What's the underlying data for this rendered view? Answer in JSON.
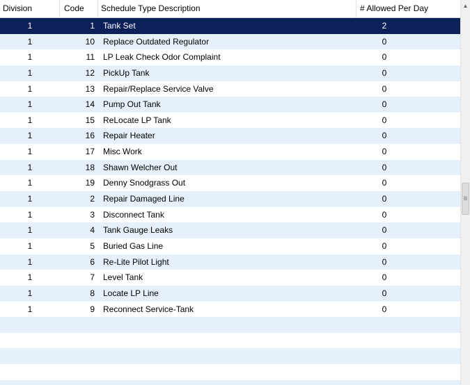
{
  "headers": {
    "division": "Division",
    "code": "Code",
    "description": "Schedule Type Description",
    "allowed": "# Allowed Per Day"
  },
  "rows": [
    {
      "division": "1",
      "code": "1",
      "description": "Tank Set",
      "allowed": "2"
    },
    {
      "division": "1",
      "code": "10",
      "description": "Replace Outdated Regulator",
      "allowed": "0"
    },
    {
      "division": "1",
      "code": "11",
      "description": "LP Leak Check Odor Complaint",
      "allowed": "0"
    },
    {
      "division": "1",
      "code": "12",
      "description": "PickUp Tank",
      "allowed": "0"
    },
    {
      "division": "1",
      "code": "13",
      "description": "Repair/Replace Service Valve",
      "allowed": "0"
    },
    {
      "division": "1",
      "code": "14",
      "description": "Pump Out Tank",
      "allowed": "0"
    },
    {
      "division": "1",
      "code": "15",
      "description": "ReLocate LP Tank",
      "allowed": "0"
    },
    {
      "division": "1",
      "code": "16",
      "description": "Repair Heater",
      "allowed": "0"
    },
    {
      "division": "1",
      "code": "17",
      "description": "Misc Work",
      "allowed": "0"
    },
    {
      "division": "1",
      "code": "18",
      "description": "Shawn Welcher Out",
      "allowed": "0"
    },
    {
      "division": "1",
      "code": "19",
      "description": "Denny Snodgrass Out",
      "allowed": "0"
    },
    {
      "division": "1",
      "code": "2",
      "description": "Repair Damaged Line",
      "allowed": "0"
    },
    {
      "division": "1",
      "code": "3",
      "description": "Disconnect Tank",
      "allowed": "0"
    },
    {
      "division": "1",
      "code": "4",
      "description": "Tank Gauge Leaks",
      "allowed": "0"
    },
    {
      "division": "1",
      "code": "5",
      "description": "Buried Gas Line",
      "allowed": "0"
    },
    {
      "division": "1",
      "code": "6",
      "description": "Re-Lite Pilot Light",
      "allowed": "0"
    },
    {
      "division": "1",
      "code": "7",
      "description": "Level Tank",
      "allowed": "0"
    },
    {
      "division": "1",
      "code": "8",
      "description": "Locate LP Line",
      "allowed": "0"
    },
    {
      "division": "1",
      "code": "9",
      "description": "Reconnect Service-Tank",
      "allowed": "0"
    }
  ],
  "empty_rows": 5,
  "selected_row": 0,
  "colors": {
    "selected": "#0c2059",
    "alt_row": "#e6f0fb"
  },
  "icons": {
    "scroll_up": "triangle-up-icon",
    "scroll_thumb_grip": "grip-icon"
  }
}
